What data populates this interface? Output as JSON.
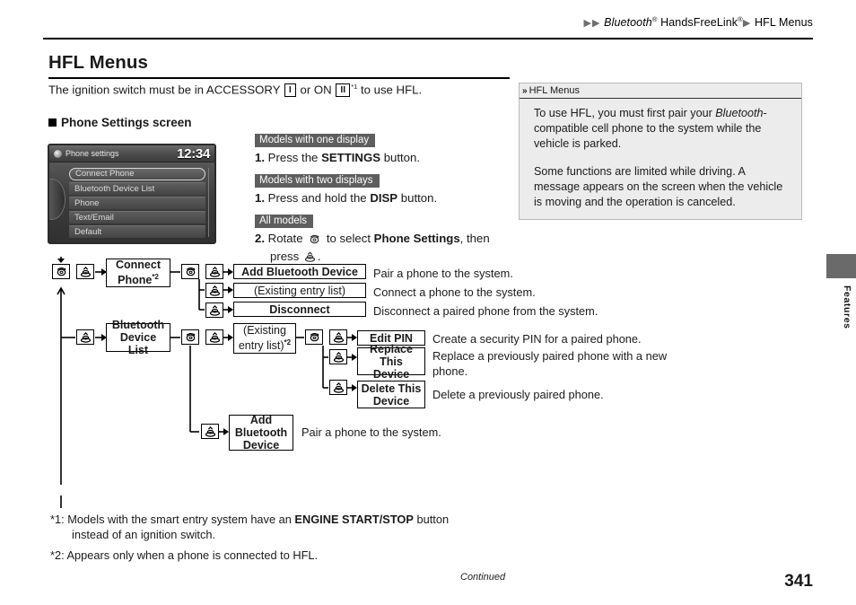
{
  "breadcrumb": {
    "seg1": "Bluetooth",
    "seg1_sup": "®",
    "seg2": "HandsFreeLink",
    "seg2_sup": "®",
    "seg3": "HFL Menus"
  },
  "header": {
    "title": "HFL Menus",
    "intro_a": "The ignition switch must be in ACCESSORY",
    "intro_key1": "I",
    "intro_b": "or ON",
    "intro_key2": "II",
    "intro_sup": "*1",
    "intro_c": "to use HFL.",
    "subhead": "Phone Settings screen"
  },
  "nav_screen": {
    "title": "Phone settings",
    "clock": "12:34",
    "rows": [
      "Connect Phone",
      "Bluetooth Device List",
      "Phone",
      "Text/Email",
      "Default"
    ]
  },
  "steps": {
    "tag_one_display": "Models with one display",
    "step1a_num": "1.",
    "step1a_pre": "Press the",
    "step1a_bold": "SETTINGS",
    "step1a_post": "button.",
    "tag_two_displays": "Models with two displays",
    "step1b_num": "1.",
    "step1b_pre": "Press and hold the",
    "step1b_bold": "DISP",
    "step1b_post": "button.",
    "tag_all_models": "All models",
    "step2_num": "2.",
    "step2_pre": "Rotate",
    "step2_mid": "to select",
    "step2_bold": "Phone Settings",
    "step2_post": ", then",
    "step2_line2_pre": "press",
    "step2_line2_post": "."
  },
  "note": {
    "icon": "chevron-double-right-icon",
    "title": "HFL Menus",
    "para1_a": "To use HFL, you must first pair your ",
    "para1_i": "Bluetooth",
    "para1_b": "-compatible cell phone to the system while the vehicle is parked.",
    "para2": "Some functions are limited while driving. A message appears on the screen when the vehicle is moving and the operation is canceled."
  },
  "side_tab": {
    "label": "Features"
  },
  "flow": {
    "nodes": {
      "connect_phone": "Connect Phone",
      "connect_phone_sup": "*2",
      "add_bt_device_1": "Add Bluetooth Device",
      "existing_entry_list_1": "(Existing entry list)",
      "disconnect": "Disconnect",
      "bt_device_list": "Bluetooth Device List",
      "existing_entry_list_2": "(Existing entry list)",
      "existing_entry_list_2_sup": "*2",
      "edit_pin": "Edit PIN",
      "replace_this_device": "Replace This Device",
      "delete_this_device": "Delete This Device",
      "add_bt_device_2": "Add Bluetooth Device"
    },
    "descriptions": {
      "add_bt_device_1": "Pair a phone to the system.",
      "existing_entry_list_1": "Connect a phone to the system.",
      "disconnect": "Disconnect a paired phone from the system.",
      "edit_pin": "Create a security PIN for a paired phone.",
      "replace_this_device": "Replace a previously paired phone with a new phone.",
      "delete_this_device": "Delete a previously paired phone.",
      "add_bt_device_2": "Pair a phone to the system."
    },
    "icons": {
      "rotary": "rotary-knob-icon",
      "press": "press-knob-icon",
      "arrow": "arrow-right-icon"
    }
  },
  "footnotes": {
    "fn1_marker": "*1:",
    "fn1_a": "Models with the smart entry system have an",
    "fn1_bold": "ENGINE START/STOP",
    "fn1_b": "button",
    "fn1_line2": "instead of an ignition switch.",
    "fn2_marker": "*2:",
    "fn2": "Appears only when a phone is connected to HFL."
  },
  "footer": {
    "continued": "Continued",
    "page_number": "341"
  }
}
